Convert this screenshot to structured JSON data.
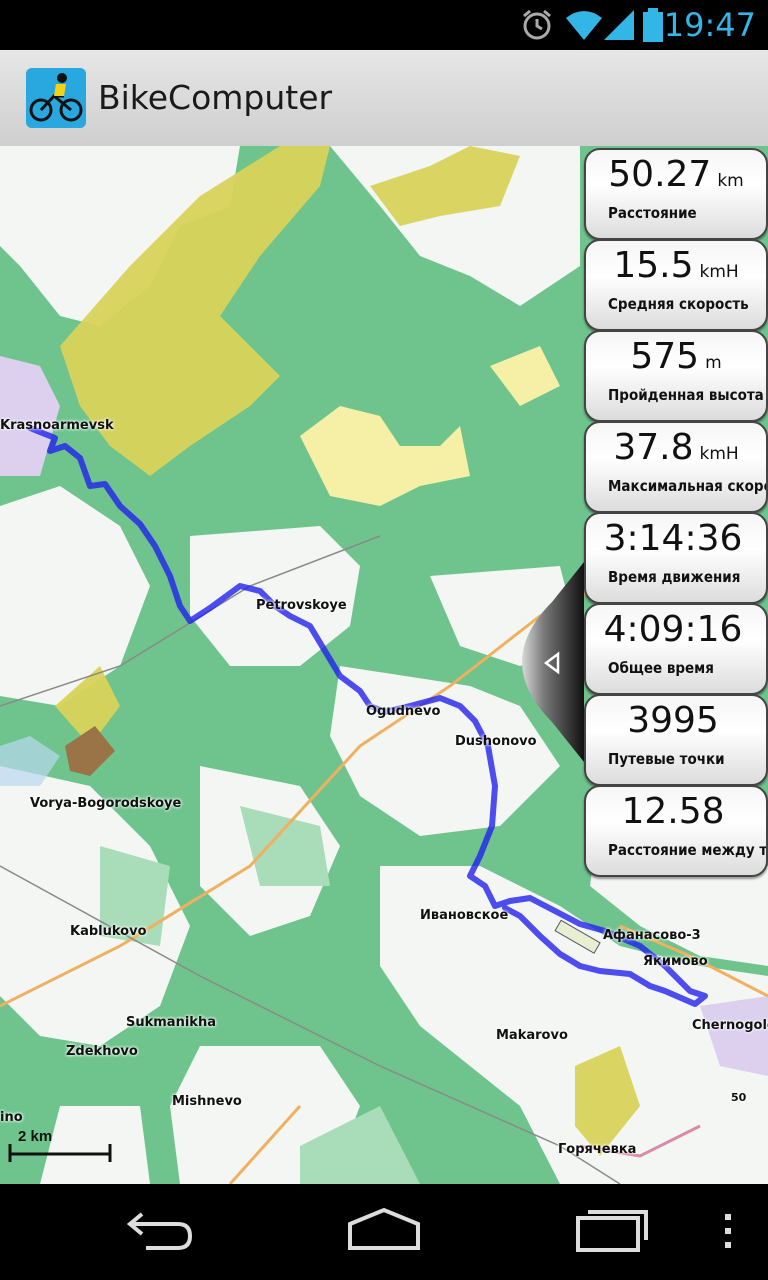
{
  "status_bar": {
    "time": "19:47",
    "icons": [
      "alarm-icon",
      "wifi-icon",
      "signal-icon",
      "battery-icon"
    ]
  },
  "app_bar": {
    "title": "BikeComputer",
    "icon": "cyclist-icon"
  },
  "map": {
    "places": [
      "Krasnoarmevsk",
      "Petrovskoye",
      "Ogudnevo",
      "Dushonovo",
      "Vorya-Bogorodskoye",
      "Kablukovo",
      "Sukmanikha",
      "Zdekhovo",
      "Mishnevo",
      "Ивановское",
      "Афанасово-3",
      "Якимово",
      "Сhernogolov",
      "Makarovo",
      "Горячевка",
      "ino"
    ],
    "road_number": "50",
    "scale_label": "2 km"
  },
  "stats": [
    {
      "value": "50.27",
      "unit": "km",
      "label": "Расстояние"
    },
    {
      "value": "15.5",
      "unit": "kmH",
      "label": "Средняя скорость"
    },
    {
      "value": "575",
      "unit": "m",
      "label": "Пройденная высота"
    },
    {
      "value": "37.8",
      "unit": "kmH",
      "label": "Максимальная скорость"
    },
    {
      "value": "3:14:36",
      "unit": "",
      "label": "Время движения"
    },
    {
      "value": "4:09:16",
      "unit": "",
      "label": "Общее время"
    },
    {
      "value": "3995",
      "unit": "",
      "label": "Путевые точки"
    },
    {
      "value": "12.58",
      "unit": "",
      "label": "Расстояние между точками"
    }
  ],
  "nav_bar": {
    "buttons": [
      "back-icon",
      "home-icon",
      "recents-icon",
      "menu-icon"
    ]
  },
  "colors": {
    "track": "#2222ee",
    "map_green": "#6ec48c",
    "accent": "#33b5e5"
  }
}
